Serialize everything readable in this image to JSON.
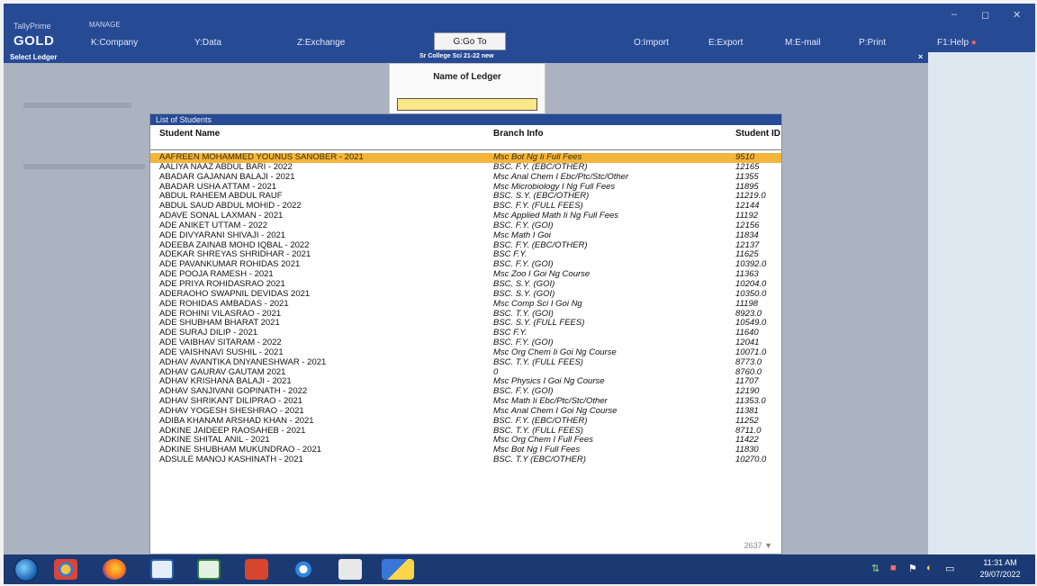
{
  "app": {
    "brand_small": "TallyPrime",
    "brand_big": "GOLD",
    "manage_label": "MANAGE"
  },
  "menu": [
    {
      "label": "K:Company"
    },
    {
      "label": "Y:Data"
    },
    {
      "label": "Z:Exchange"
    },
    {
      "label": "G:Go To"
    },
    {
      "label": "O:Import"
    },
    {
      "label": "E:Export"
    },
    {
      "label": "M:E-mail"
    },
    {
      "label": "P:Print"
    },
    {
      "label": "F1:Help"
    }
  ],
  "window_controls": {
    "minimize": "–",
    "restore": "◻",
    "close": "✕"
  },
  "subbar": {
    "left": "Select Ledger",
    "center": "Sr College Sci 21-22 new",
    "close": "×"
  },
  "ledger_box": {
    "title": "Name of Ledger",
    "value": ""
  },
  "list": {
    "title": "List of Students",
    "headers": {
      "name": "Student Name",
      "branch": "Branch Info",
      "id": "Student ID"
    },
    "count": "2637 ▼",
    "rows": [
      {
        "name": "AAFREEN MOHAMMED YOUNUS SANOBER - 2021",
        "branch": "Msc Bot Ng Ii Full Fees",
        "id": "9510"
      },
      {
        "name": "AALIYA NAAZ ABDUL BARI - 2022",
        "branch": "BSC. F.Y. (EBC/OTHER)",
        "id": "12165"
      },
      {
        "name": "ABADAR GAJANAN BALAJI - 2021",
        "branch": "Msc Anal Chem I Ebc/Ptc/Stc/Other",
        "id": "11355"
      },
      {
        "name": "ABADAR USHA ATTAM - 2021",
        "branch": "Msc Microbiology I Ng Full Fees",
        "id": "11895"
      },
      {
        "name": "ABDUL RAHEEM ABDUL RAUF",
        "branch": "BSC. S.Y. (EBC/OTHER)",
        "id": "11219.0"
      },
      {
        "name": "ABDUL SAUD ABDUL MOHID - 2022",
        "branch": "BSC. F.Y. (FULL FEES)",
        "id": "12144"
      },
      {
        "name": "ADAVE SONAL LAXMAN - 2021",
        "branch": "Msc Applied Math Ii Ng Full Fees",
        "id": "11192"
      },
      {
        "name": "ADE ANIKET UTTAM - 2022",
        "branch": "BSC. F.Y. (GOI)",
        "id": "12156"
      },
      {
        "name": "ADE DIVYARANI SHIVAJI - 2021",
        "branch": "Msc Math I Goi",
        "id": "11834"
      },
      {
        "name": "ADEEBA ZAINAB MOHD IQBAL - 2022",
        "branch": "BSC. F.Y. (EBC/OTHER)",
        "id": "12137"
      },
      {
        "name": "ADEKAR SHREYAS SHRIDHAR - 2021",
        "branch": "BSC F.Y.",
        "id": "11625"
      },
      {
        "name": "ADE PAVANKUMAR ROHIDAS 2021",
        "branch": "BSC. F.Y. (GOI)",
        "id": "10392.0"
      },
      {
        "name": "ADE POOJA RAMESH - 2021",
        "branch": "Msc Zoo I Goi Ng Course",
        "id": "11363"
      },
      {
        "name": "ADE PRIYA ROHIDASRAO 2021",
        "branch": "BSC. S.Y. (GOI)",
        "id": "10204.0"
      },
      {
        "name": "ADERAOHO SWAPNIL DEVIDAS 2021",
        "branch": "BSC. S.Y. (GOI)",
        "id": "10350.0"
      },
      {
        "name": "ADE ROHIDAS AMBADAS - 2021",
        "branch": "Msc Comp Sci I Goi Ng",
        "id": "11198"
      },
      {
        "name": "ADE ROHINI VILASRAO - 2021",
        "branch": "BSC. T.Y. (GOI)",
        "id": "8923.0"
      },
      {
        "name": "ADE SHUBHAM BHARAT 2021",
        "branch": "BSC. S.Y. (FULL FEES)",
        "id": "10549.0"
      },
      {
        "name": "ADE SURAJ DILIP - 2021",
        "branch": "BSC F.Y.",
        "id": "11640"
      },
      {
        "name": "ADE VAIBHAV SITARAM - 2022",
        "branch": "BSC. F.Y. (GOI)",
        "id": "12041"
      },
      {
        "name": "ADE VAISHNAVI SUSHIL - 2021",
        "branch": "Msc Org Chem Ii Goi Ng Course",
        "id": "10071.0"
      },
      {
        "name": "ADHAV AVANTIKA DNYANESHWAR - 2021",
        "branch": "BSC. T.Y. (FULL FEES)",
        "id": "8773.0"
      },
      {
        "name": "ADHAV GAURAV GAUTAM 2021",
        "branch": "0",
        "id": "8760.0"
      },
      {
        "name": "ADHAV KRISHANA BALAJI - 2021",
        "branch": "Msc Physics I Goi Ng Course",
        "id": "11707"
      },
      {
        "name": "ADHAV SANJIVANI GOPINATH - 2022",
        "branch": "BSC. F.Y. (GOI)",
        "id": "12190"
      },
      {
        "name": "ADHAV SHRIKANT DILIPRAO - 2021",
        "branch": "Msc Math Ii Ebc/Ptc/Stc/Other",
        "id": "11353.0"
      },
      {
        "name": "ADHAV YOGESH SHESHRAO - 2021",
        "branch": "Msc Anal Chem I Goi Ng Course",
        "id": "11381"
      },
      {
        "name": "ADIBA KHANAM ARSHAD KHAN - 2021",
        "branch": "BSC. F.Y. (EBC/OTHER)",
        "id": "11252"
      },
      {
        "name": "ADKINE JAIDEEP RAOSAHEB - 2021",
        "branch": "BSC. T.Y. (FULL FEES)",
        "id": "8711.0"
      },
      {
        "name": "ADKINE SHITAL ANIL - 2021",
        "branch": "Msc Org Chem I Full Fees",
        "id": "11422"
      },
      {
        "name": "ADKINE SHUBHAM MUKUNDRAO - 2021",
        "branch": "Msc Bot Ng I Full Fees",
        "id": "11830"
      },
      {
        "name": "ADSULE MANOJ KASHINATH - 2021",
        "branch": "BSC. T.Y (EBC/OTHER)",
        "id": "10270.0"
      }
    ]
  },
  "taskbar": {
    "time": "11:31 AM",
    "date": "29/07/2022"
  }
}
